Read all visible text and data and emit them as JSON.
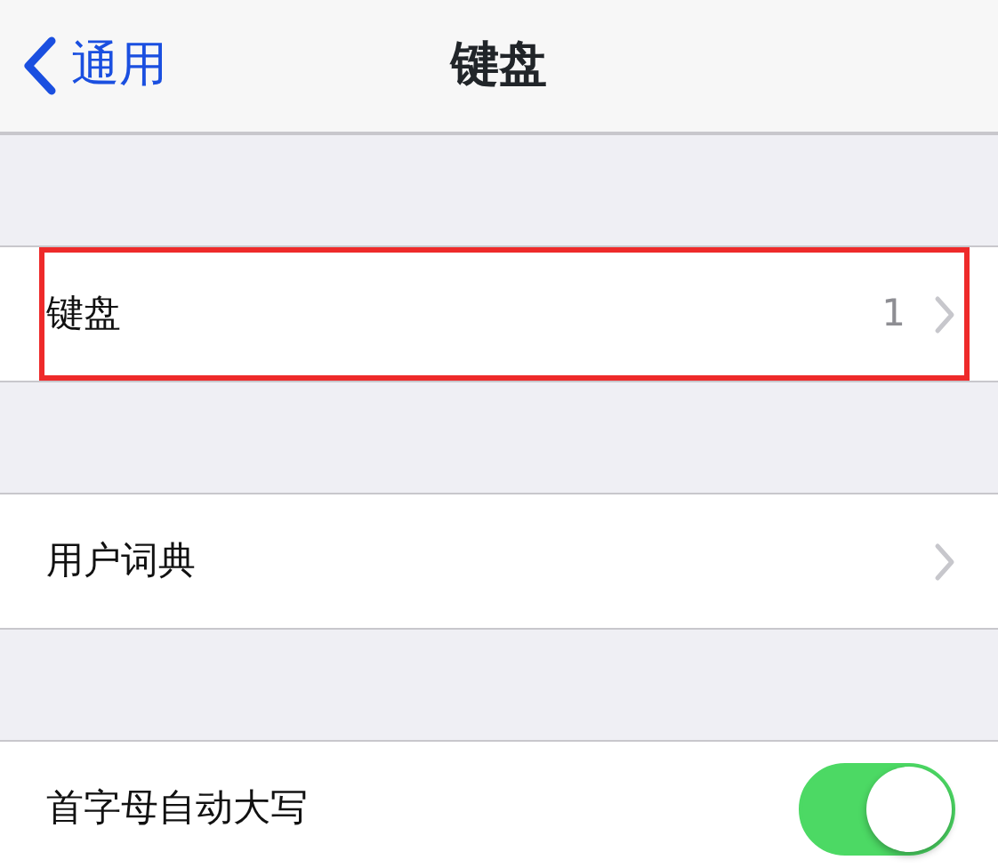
{
  "nav_bar": {
    "back_label": "通用",
    "title": "键盘"
  },
  "groups": [
    {
      "rows": [
        {
          "kind": "link",
          "label": "键盘",
          "detail": "1",
          "highlighted": true
        }
      ]
    },
    {
      "rows": [
        {
          "kind": "link",
          "label": "用户词典",
          "highlighted": false
        }
      ]
    },
    {
      "rows": [
        {
          "kind": "toggle",
          "label": "首字母自动大写",
          "on": true,
          "highlighted": false
        }
      ]
    }
  ]
}
